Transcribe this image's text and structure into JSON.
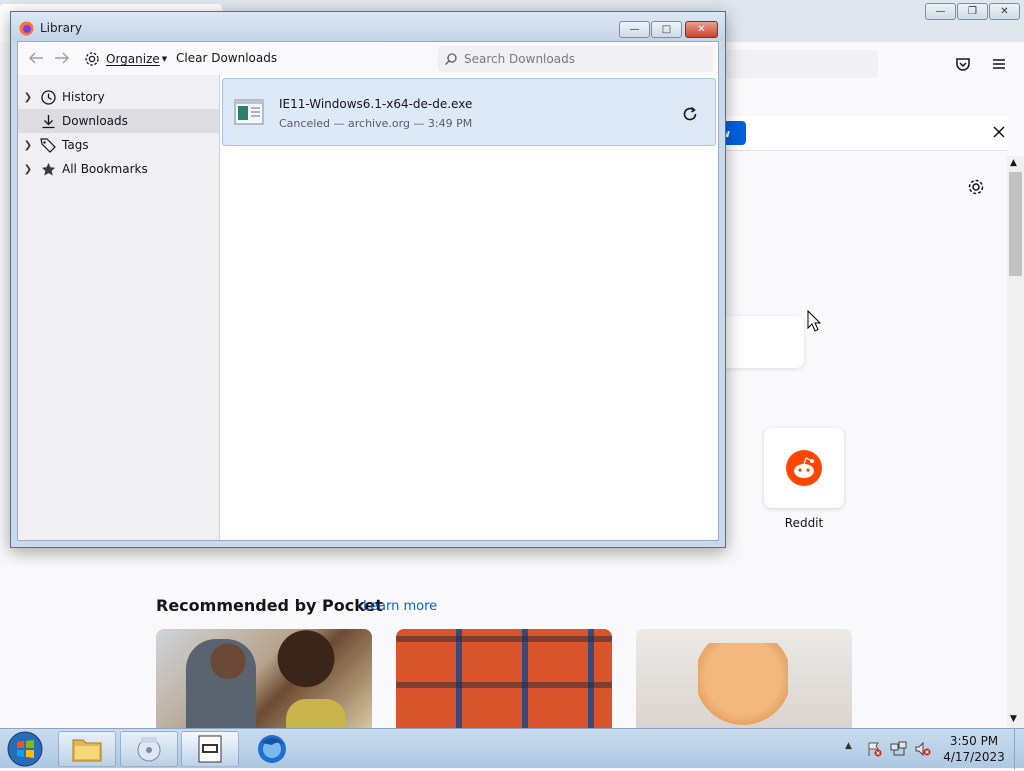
{
  "library": {
    "title": "Library",
    "toolbar": {
      "organize_label": "Organize",
      "clear_downloads_label": "Clear Downloads",
      "search_placeholder": "Search Downloads"
    },
    "sidebar": {
      "items": [
        {
          "label": "History"
        },
        {
          "label": "Downloads"
        },
        {
          "label": "Tags"
        },
        {
          "label": "All Bookmarks"
        }
      ]
    },
    "downloads": [
      {
        "filename": "IE11-Windows6.1-x64-de-de.exe",
        "status": "Canceled — archive.org — 3:49 PM"
      }
    ]
  },
  "firefox": {
    "notification_button_label": "w",
    "topsites": [
      {
        "label": "Reddit"
      }
    ],
    "pocket": {
      "title": "Recommended by Pocket",
      "learn_more": "Learn more"
    }
  },
  "taskbar": {
    "clock_time": "3:50 PM",
    "clock_date": "4/17/2023"
  },
  "colors": {
    "accent": "#0061e0",
    "reddit": "#ff4500",
    "selection": "#dde9f8"
  }
}
